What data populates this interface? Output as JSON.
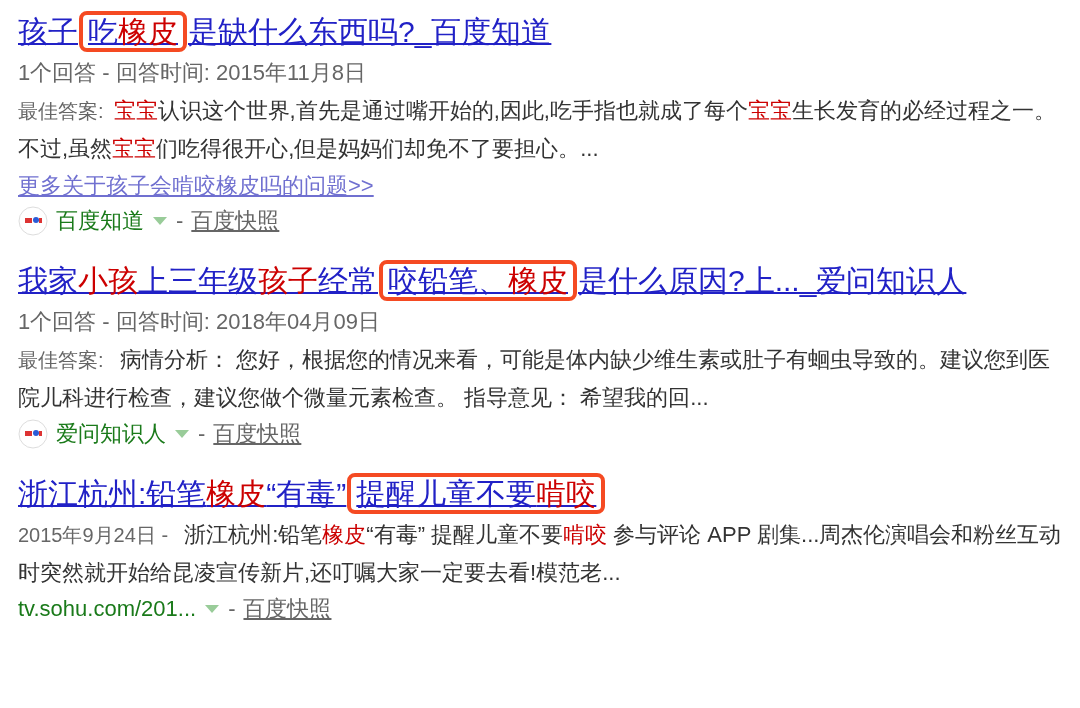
{
  "results": [
    {
      "title": [
        {
          "text": "孩子",
          "em": false,
          "annotated": false
        },
        {
          "text": "吃",
          "em": false,
          "annotated": true
        },
        {
          "text": "橡皮",
          "em": true,
          "annotated": true
        },
        {
          "text": "是缺什么东西吗?_百度知道",
          "em": false,
          "annotated": false
        }
      ],
      "meta": "1个回答 - 回答时间: 2015年11月8日",
      "snippet_lead": "最佳答案:",
      "snippet": [
        {
          "text": "宝宝",
          "em": true
        },
        {
          "text": "认识这个世界,首先是通过嘴开始的,因此,吃手指也就成了每个",
          "em": false
        },
        {
          "text": "宝宝",
          "em": true
        },
        {
          "text": "生长发育的必经过程之一。不过,虽然",
          "em": false
        },
        {
          "text": "宝宝",
          "em": true
        },
        {
          "text": "们吃得很开心,但是妈妈们却免不了要担心。...",
          "em": false
        }
      ],
      "more_link": "更多关于孩子会啃咬橡皮吗的问题>>",
      "source": "百度知道",
      "has_icon": true,
      "separator": "-",
      "snapshot": "百度快照"
    },
    {
      "title": [
        {
          "text": "我家",
          "em": false,
          "annotated": false
        },
        {
          "text": "小孩",
          "em": true,
          "annotated": false
        },
        {
          "text": "上三年级",
          "em": false,
          "annotated": false
        },
        {
          "text": "孩子",
          "em": true,
          "annotated": false
        },
        {
          "text": "经常",
          "em": false,
          "annotated": false
        },
        {
          "text": "咬铅笔、",
          "em": false,
          "annotated": true
        },
        {
          "text": "橡皮",
          "em": true,
          "annotated": true
        },
        {
          "text": "是什么原因?上..._爱问知识人",
          "em": false,
          "annotated": false
        }
      ],
      "meta": "1个回答 - 回答时间: 2018年04月09日",
      "snippet_lead": "最佳答案:",
      "snippet": [
        {
          "text": " 病情分析： 您好，根据您的情况来看，可能是体内缺少维生素或肚子有蛔虫导致的。建议您到医院儿科进行检查，建议您做个微量元素检查。 指导意见： 希望我的回...",
          "em": false
        }
      ],
      "source": "爱问知识人",
      "has_icon": true,
      "separator": "-",
      "snapshot": "百度快照"
    },
    {
      "title": [
        {
          "text": "浙江杭州:铅笔",
          "em": false,
          "annotated": false
        },
        {
          "text": "橡皮",
          "em": true,
          "annotated": false
        },
        {
          "text": "“有毒”",
          "em": false,
          "annotated": false
        },
        {
          "text": "提醒儿童不要",
          "em": false,
          "annotated": true
        },
        {
          "text": "啃咬",
          "em": true,
          "annotated": true
        }
      ],
      "snippet_lead": "2015年9月24日 -",
      "snippet": [
        {
          "text": " 浙江杭州:铅笔",
          "em": false
        },
        {
          "text": "橡皮",
          "em": true
        },
        {
          "text": "“有毒” 提醒儿童不要",
          "em": false
        },
        {
          "text": "啃咬",
          "em": true
        },
        {
          "text": " 参与评论 APP 剧集...周杰伦演唱会和粉丝互动时突然就开始给昆凌宣传新片,还叮嘱大家一定要去看!模范老...",
          "em": false
        }
      ],
      "source": "tv.sohu.com/201...",
      "has_icon": false,
      "separator": "-",
      "snapshot": "百度快照"
    }
  ]
}
